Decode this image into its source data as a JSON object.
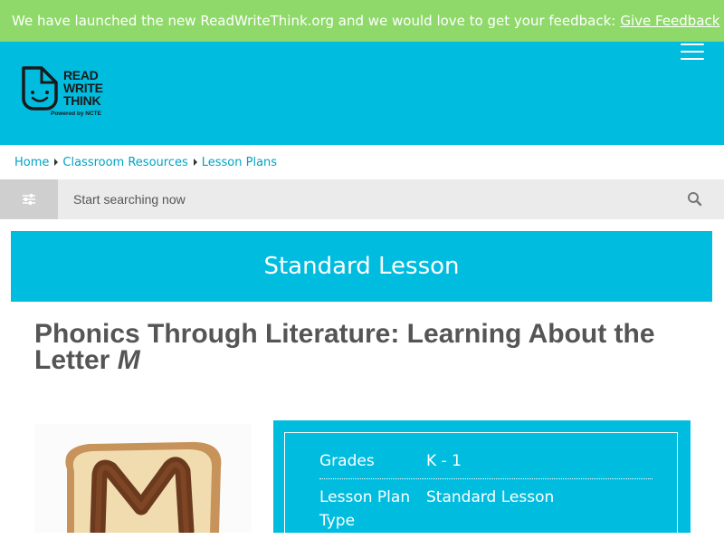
{
  "banner": {
    "message": "We have launched the new ReadWriteThink.org and we would love to get your feedback:",
    "link_label": "Give Feedback",
    "color": "#8fd96a"
  },
  "header": {
    "color": "#00bde0",
    "logo": {
      "words": [
        "READ",
        "WRITE",
        "THINK"
      ],
      "powered_by": "Powered by NCTE"
    },
    "menu_icon": "hamburger-menu-icon"
  },
  "breadcrumb": {
    "items": [
      {
        "label": "Home"
      },
      {
        "label": "Classroom Resources"
      },
      {
        "label": "Lesson Plans"
      }
    ]
  },
  "search": {
    "placeholder": "Start searching now",
    "filter_icon": "sliders-icon",
    "search_icon": "search-icon"
  },
  "lesson_type_banner": {
    "label": "Standard Lesson"
  },
  "page": {
    "title_main": "Phonics Through Literature: Learning About the Letter",
    "title_letter": "M"
  },
  "info": {
    "rows": [
      {
        "label": "Grades",
        "value": "K - 1"
      },
      {
        "label": "Lesson Plan Type",
        "value": "Standard Lesson"
      }
    ]
  }
}
